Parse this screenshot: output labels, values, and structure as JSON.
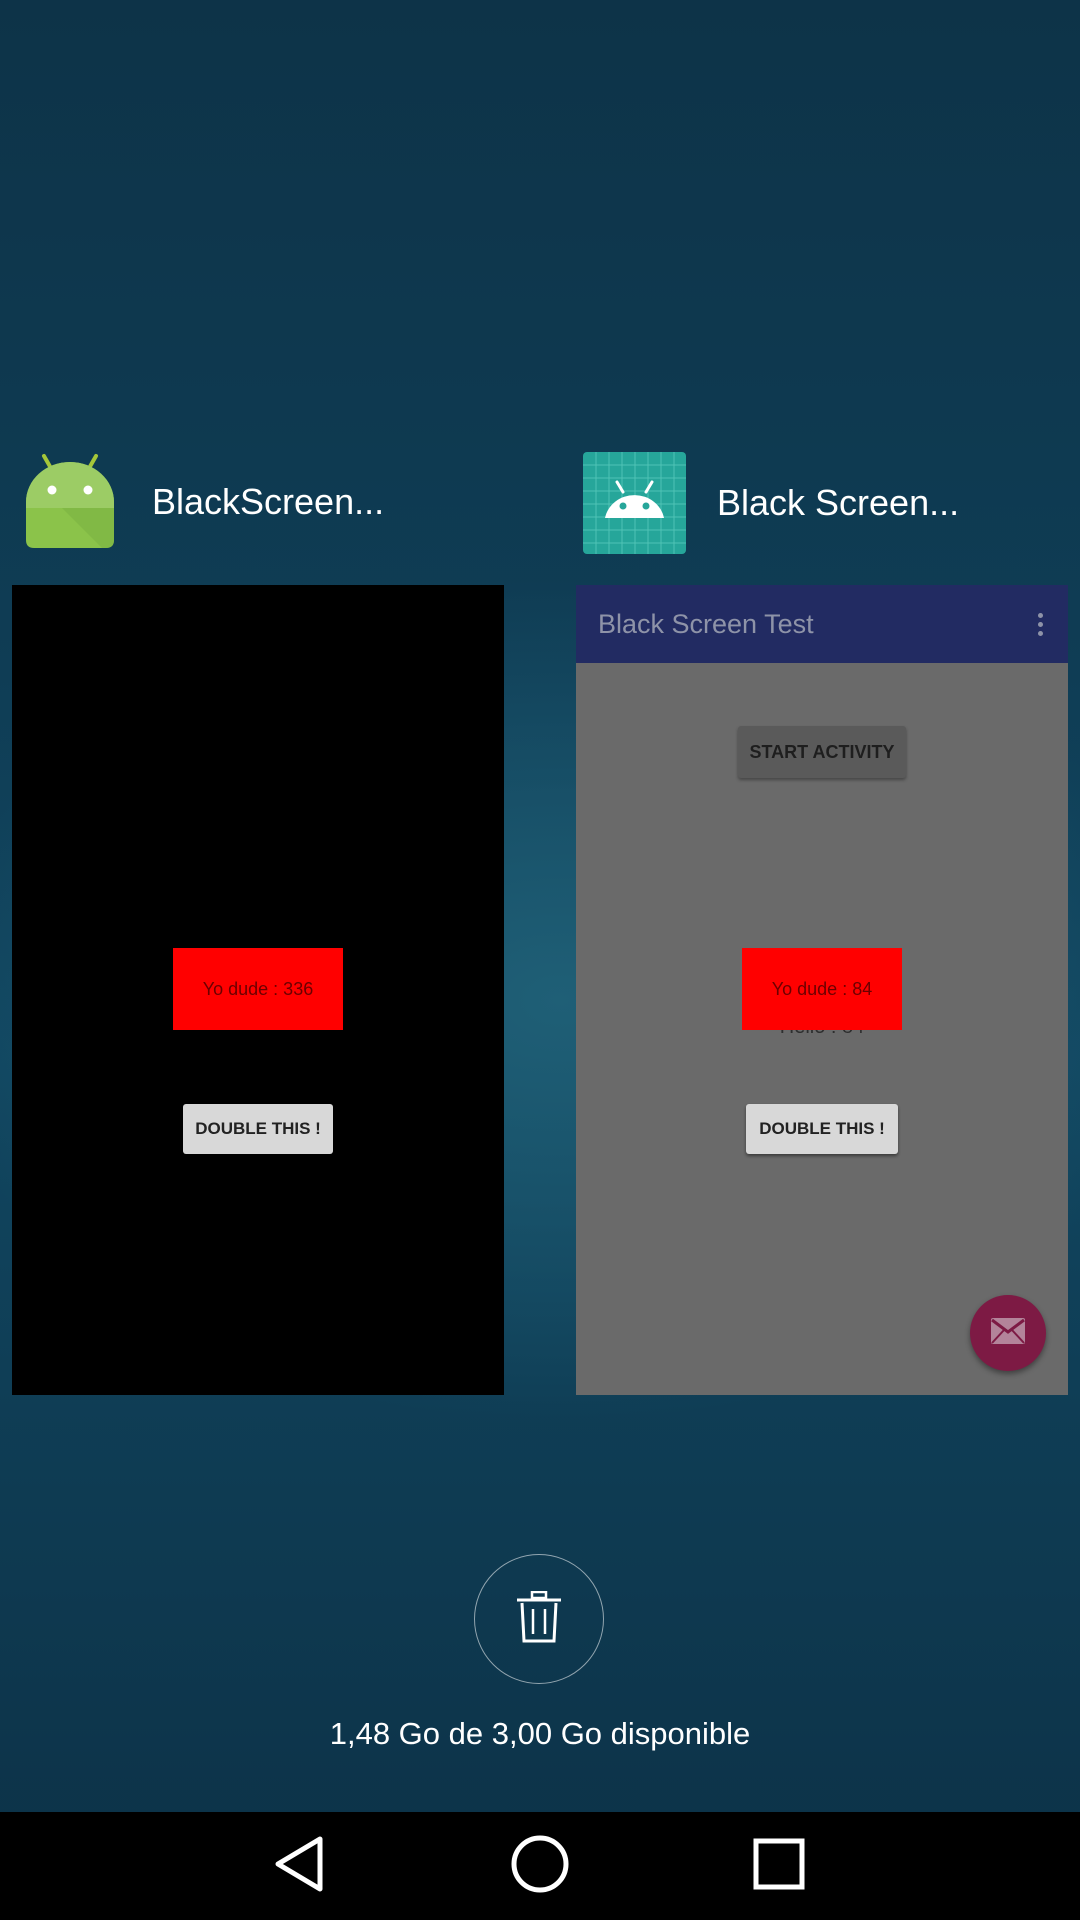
{
  "recents": {
    "apps": [
      {
        "title": "BlackScreen...",
        "icon": "android-robot-icon",
        "thumbnail": {
          "counter_text": "Yo dude : 336",
          "button_label": "DOUBLE THIS !"
        }
      },
      {
        "title": "Black Screen...",
        "icon": "android-grid-icon",
        "thumbnail": {
          "toolbar_title": "Black Screen Test",
          "start_button_label": "START ACTIVITY",
          "counter_text": "Yo dude : 84",
          "hello_text": "Hello : 84",
          "button_label": "DOUBLE THIS !",
          "fab_icon": "mail-icon"
        }
      }
    ],
    "clear_all_icon": "trash-icon",
    "memory_text": "1,48 Go de 3,00 Go disponible"
  },
  "navbar": {
    "back_icon": "back-triangle-icon",
    "home_icon": "home-circle-icon",
    "recents_icon": "recents-square-icon"
  },
  "colors": {
    "accent_red": "#ff0000",
    "toolbar": "#222b62",
    "fab": "#7d1a44"
  }
}
